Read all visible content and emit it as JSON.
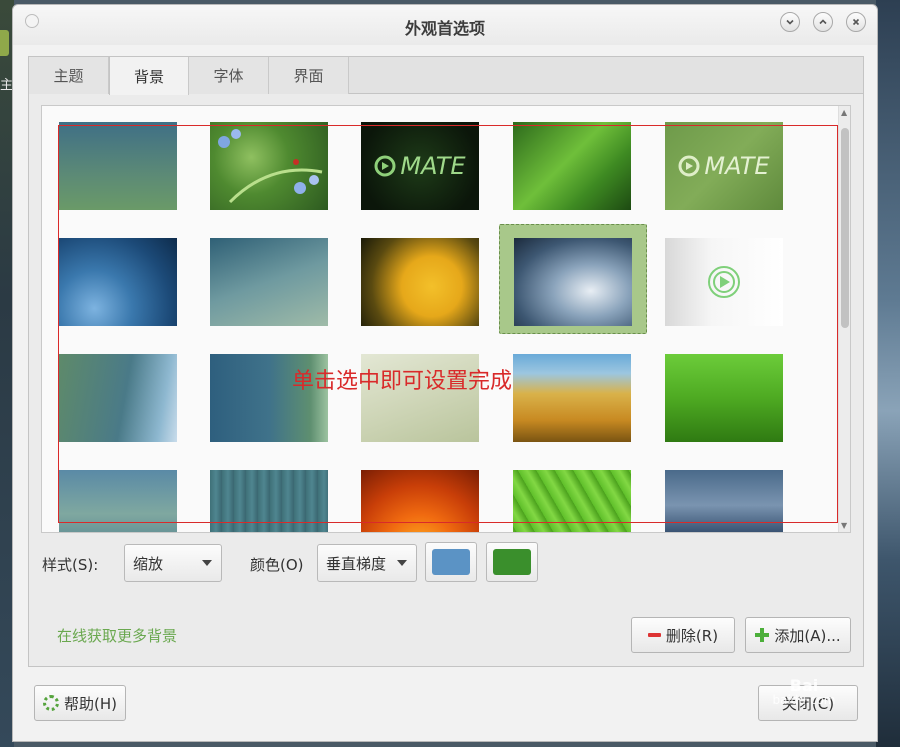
{
  "window": {
    "title": "外观首选项"
  },
  "desktop": {
    "left_label": "主"
  },
  "tabs": [
    {
      "label": "主题"
    },
    {
      "label": "背景"
    },
    {
      "label": "字体"
    },
    {
      "label": "界面"
    }
  ],
  "thumb_texts": {
    "mate_logo": "MATE"
  },
  "annotation": {
    "text": "单击选中即可设置完成"
  },
  "controls": {
    "style_label": "样式(S):",
    "style_value": "缩放",
    "color_label": "颜色(O)",
    "color_mode_value": "垂直梯度",
    "primary_color": "#5b93c5",
    "secondary_color": "#3a8f2c"
  },
  "links": {
    "online": "在线获取更多背景"
  },
  "buttons": {
    "delete": "删除(R)",
    "add": "添加(A)...",
    "help": "帮助(H)",
    "close": "关闭(C)"
  },
  "watermark": {
    "line1": "Bai",
    "line2": "baidu.com"
  }
}
